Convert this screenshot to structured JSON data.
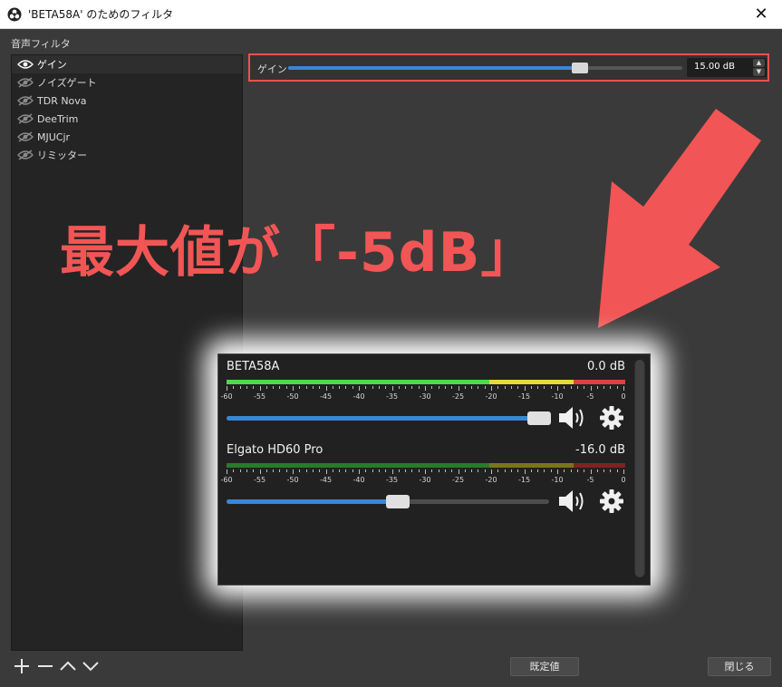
{
  "window": {
    "title": "'BETA58A' のためのフィルタ",
    "close_label": "✕"
  },
  "filters": {
    "section_label": "音声フィルタ",
    "items": [
      {
        "label": "ゲイン",
        "visible": true,
        "selected": true
      },
      {
        "label": "ノイズゲート",
        "visible": false,
        "selected": false
      },
      {
        "label": "TDR Nova",
        "visible": false,
        "selected": false
      },
      {
        "label": "DeeTrim",
        "visible": false,
        "selected": false
      },
      {
        "label": "MJUCjr",
        "visible": false,
        "selected": false
      },
      {
        "label": "リミッター",
        "visible": false,
        "selected": false
      }
    ]
  },
  "gain": {
    "label": "ゲイン",
    "value_text": "15.00 dB",
    "slider_fraction": 0.74
  },
  "annotation": {
    "text": "最大値が「-5dB」",
    "color": "#f25555"
  },
  "mixer": {
    "channels": [
      {
        "name": "BETA58A",
        "db": "0.0 dB",
        "meter_active": true,
        "volume_fraction": 0.97
      },
      {
        "name": "Elgato HD60 Pro",
        "db": "-16.0 dB",
        "meter_active": false,
        "volume_fraction": 0.53
      }
    ],
    "scale_ticks": [
      "-60",
      "-55",
      "-50",
      "-45",
      "-40",
      "-35",
      "-30",
      "-25",
      "-20",
      "-15",
      "-10",
      "-5",
      "0"
    ],
    "icons": {
      "volume": "speaker-icon",
      "settings": "gear-icon"
    }
  },
  "toolbar": {
    "add_icon": "plus-icon",
    "remove_icon": "minus-icon",
    "up_icon": "chevron-up-icon",
    "down_icon": "chevron-down-icon",
    "defaults_label": "既定値",
    "close_label": "閉じる"
  },
  "colors": {
    "highlight": "#f05050",
    "slider": "#3a86d6",
    "meter_green": "#4ddb4d",
    "meter_yellow": "#e6d93a",
    "meter_red": "#e04040"
  }
}
